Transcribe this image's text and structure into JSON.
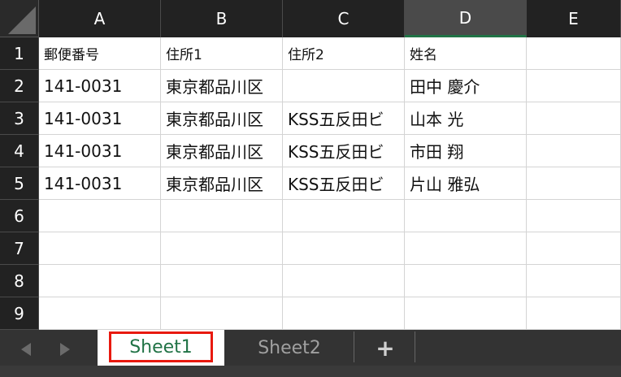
{
  "sheet": {
    "columns": [
      "A",
      "B",
      "C",
      "D",
      "E"
    ],
    "selected_column": "D",
    "rows": [
      "1",
      "2",
      "3",
      "4",
      "5",
      "6",
      "7",
      "8",
      "9"
    ],
    "cells": [
      [
        "郵便番号",
        "住所1",
        "住所2",
        "姓名",
        ""
      ],
      [
        "141-0031",
        "東京都品川区",
        "",
        "田中 慶介",
        ""
      ],
      [
        "141-0031",
        "東京都品川区",
        "KSS五反田ビ",
        "山本 光",
        ""
      ],
      [
        "141-0031",
        "東京都品川区",
        "KSS五反田ビ",
        "市田 翔",
        ""
      ],
      [
        "141-0031",
        "東京都品川区",
        "KSS五反田ビ",
        "片山 雅弘",
        ""
      ],
      [
        "",
        "",
        "",
        "",
        ""
      ],
      [
        "",
        "",
        "",
        "",
        ""
      ],
      [
        "",
        "",
        "",
        "",
        ""
      ],
      [
        "",
        "",
        "",
        "",
        ""
      ]
    ]
  },
  "tabs": {
    "active": "Sheet1",
    "items": [
      "Sheet1",
      "Sheet2"
    ],
    "add_label": "+"
  },
  "colors": {
    "accent_green": "#217346",
    "highlight_red": "#e8190f"
  }
}
